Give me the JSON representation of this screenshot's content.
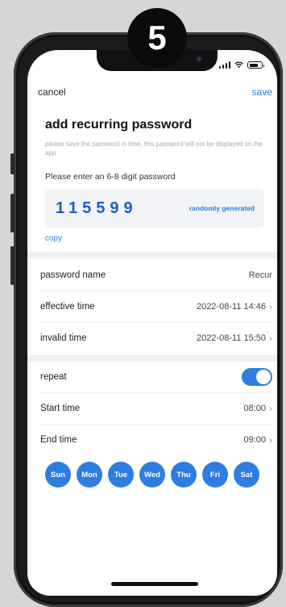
{
  "step_badge": "5",
  "header": {
    "cancel_label": "cancel",
    "save_label": "save"
  },
  "title": "add recurring password",
  "hint": "please save the password in time, this password will not be displayed on the app",
  "password": {
    "prompt": "Please enter an 6-8 digit password",
    "value": "115599",
    "random_label": "randomly generated",
    "copy_label": "copy"
  },
  "rows": {
    "password_name": {
      "label": "password name",
      "value": "Recur"
    },
    "effective_time": {
      "label": "effective time",
      "value": "2022-08-11 14:46"
    },
    "invalid_time": {
      "label": "invalid time",
      "value": "2022-08-11 15:50"
    },
    "repeat": {
      "label": "repeat",
      "enabled": true
    },
    "start_time": {
      "label": "Start time",
      "value": "08:00"
    },
    "end_time": {
      "label": "End time",
      "value": "09:00"
    }
  },
  "days": [
    "Sun",
    "Mon",
    "Tue",
    "Wed",
    "Thu",
    "Fri",
    "Sat"
  ],
  "colors": {
    "accent": "#2f7de1",
    "badge": "#0a0a0a"
  },
  "icons": {
    "chevron": "chevron-right-icon",
    "signal": "signal-icon",
    "wifi": "wifi-icon",
    "battery": "battery-icon"
  }
}
